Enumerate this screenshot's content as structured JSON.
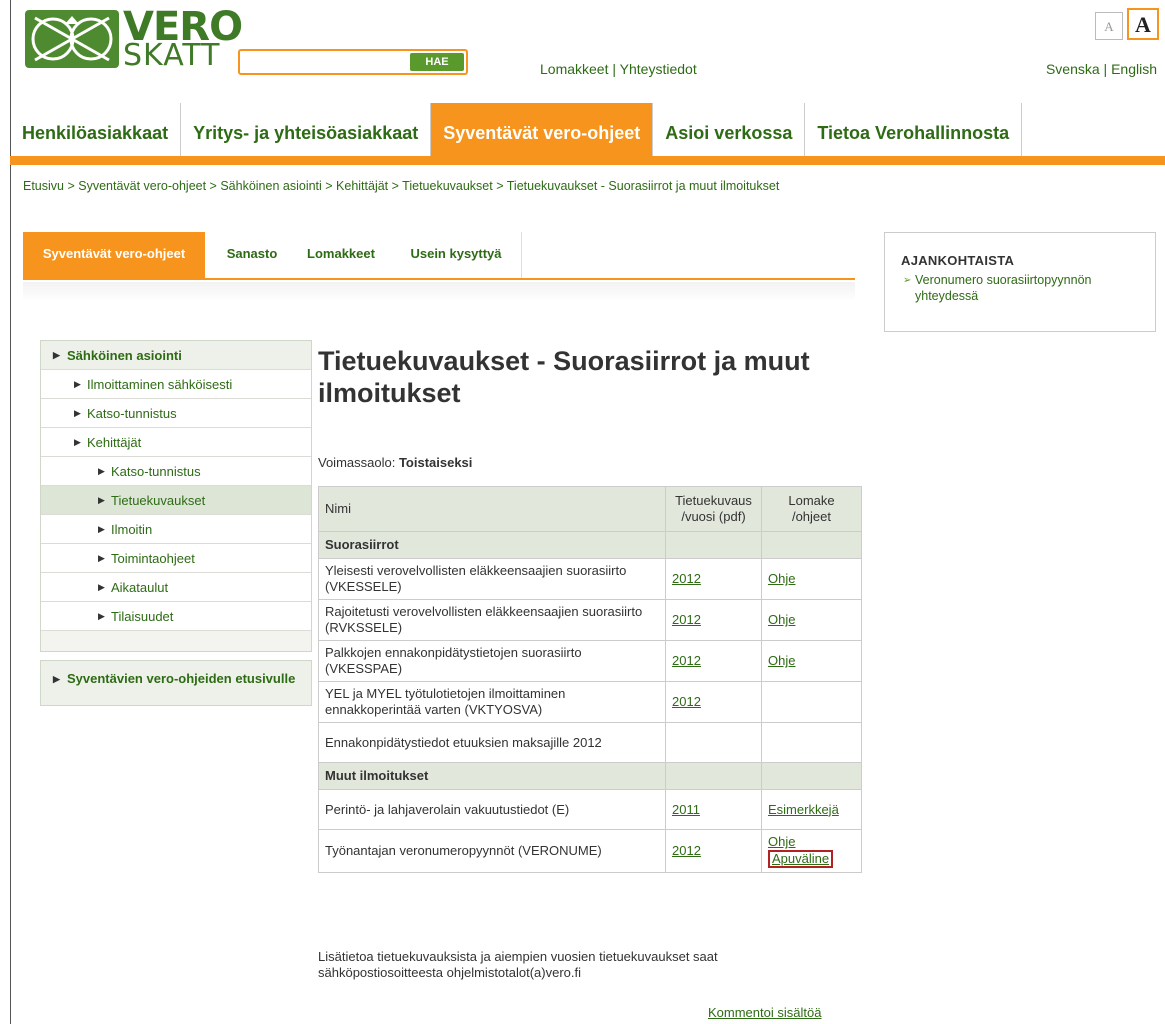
{
  "header": {
    "logo_top": "VERO",
    "logo_bottom": "SKATT",
    "search": {
      "placeholder": "",
      "button_label": "HAE"
    },
    "links": {
      "forms": "Lomakkeet",
      "sep": " | ",
      "contacts": "Yhteystiedot"
    },
    "lang": {
      "sv": "Svenska",
      "sep": " | ",
      "en": "English"
    },
    "fontsize": {
      "small": "A",
      "large": "A"
    }
  },
  "mainnav": [
    {
      "label": "Henkilöasiakkaat",
      "active": false
    },
    {
      "label": "Yritys- ja yhteisöasiakkaat",
      "active": false
    },
    {
      "label": "Syventävät vero-ohjeet",
      "active": true
    },
    {
      "label": "Asioi verkossa",
      "active": false
    },
    {
      "label": "Tietoa Verohallinnosta",
      "active": false
    }
  ],
  "breadcrumb": "Etusivu > Syventävät vero-ohjeet > Sähköinen asiointi > Kehittäjät > Tietuekuvaukset > Tietuekuvaukset - Suorasiirrot ja muut ilmoitukset",
  "subtabs": [
    {
      "label": "Syventävät vero-ohjeet",
      "active": true
    },
    {
      "label": "Sanasto",
      "active": false
    },
    {
      "label": "Lomakkeet",
      "active": false
    },
    {
      "label": "Usein kysyttyä",
      "active": false
    }
  ],
  "rightbox": {
    "title": "AJANKOHTAISTA",
    "link": "Veronumero suorasiirtopyynnön yhteydessä"
  },
  "sidebar": {
    "top": "Sähköinen asiointi",
    "items": [
      {
        "label": "Ilmoittaminen sähköisesti",
        "level": 1
      },
      {
        "label": "Katso-tunnistus",
        "level": 1
      },
      {
        "label": "Kehittäjät",
        "level": 1
      },
      {
        "label": "Katso-tunnistus",
        "level": 2
      },
      {
        "label": "Tietuekuvaukset",
        "level": 2,
        "selected": true
      },
      {
        "label": "Ilmoitin",
        "level": 2
      },
      {
        "label": "Toimintaohjeet",
        "level": 2
      },
      {
        "label": "Aikataulut",
        "level": 2
      },
      {
        "label": "Tilaisuudet",
        "level": 2
      }
    ],
    "back": "Syventävien vero-ohjeiden etusivulle"
  },
  "content": {
    "title": "Tietuekuvaukset - Suorasiirrot ja muut ilmoitukset",
    "validity_label": "Voimassaolo: ",
    "validity_value": "Toistaiseksi",
    "table": {
      "headers": {
        "name": "Nimi",
        "record": "Tietuekuvaus /vuosi (pdf)",
        "form": "Lomake /ohjeet"
      },
      "sections": [
        {
          "title": "Suorasiirrot",
          "rows": [
            {
              "name": "Yleisesti verovelvollisten eläkkeensaajien suorasiirto (VKESSELE)",
              "year": "2012",
              "links": [
                "Ohje"
              ]
            },
            {
              "name": "Rajoitetusti verovelvollisten eläkkeensaajien suorasiirto (RVKSSELE)",
              "year": "2012",
              "links": [
                "Ohje"
              ]
            },
            {
              "name": "Palkkojen ennakonpidätystietojen suorasiirto (VKESSPAE)",
              "year": "2012",
              "links": [
                "Ohje"
              ]
            },
            {
              "name": "YEL ja MYEL työtulotietojen ilmoittaminen ennakkoperintää varten (VKTYOSVA)",
              "year": "2012",
              "links": []
            },
            {
              "name": "Ennakonpidätystiedot etuuksien maksajille 2012",
              "year": "",
              "links": []
            }
          ]
        },
        {
          "title": "Muut ilmoitukset",
          "rows": [
            {
              "name": "Perintö- ja lahjaverolain vakuutustiedot (E)",
              "year": "2011",
              "links": [
                "Esimerkkejä"
              ]
            },
            {
              "name": "Työnantajan veronumeropyynnöt (VERONUME)",
              "year": "2012",
              "links": [
                "Ohje",
                "Apuväline"
              ]
            }
          ]
        }
      ]
    },
    "footer_note": "Lisätietoa tietuekuvauksista ja aiempien vuosien tietuekuvaukset saat sähköpostiosoitteesta ohjelmistotalot(a)vero.fi",
    "comment_link": "Kommentoi sisältöä"
  },
  "colors": {
    "brand_green": "#2e6b15",
    "accent_orange": "#f7941d",
    "highlight_red": "#b22222"
  }
}
